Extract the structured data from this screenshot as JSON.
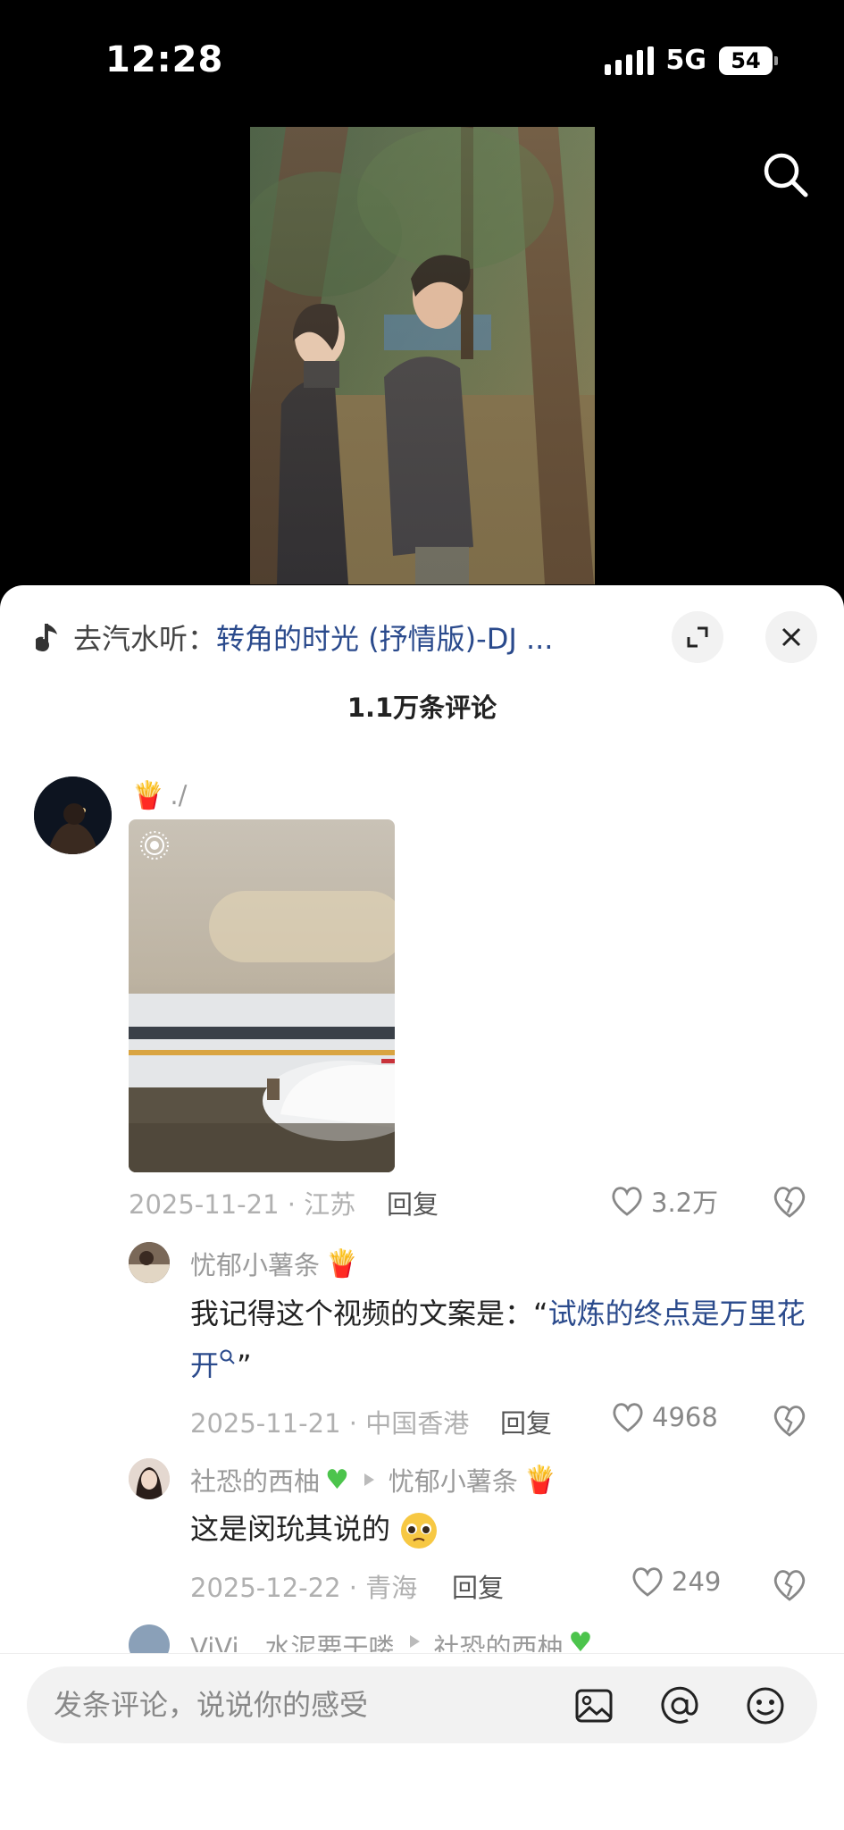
{
  "status": {
    "time": "12:28",
    "network": "5G",
    "battery": "54"
  },
  "music": {
    "prefix": "去汽水听：",
    "song": "转角的时光 (抒情版)-DJ ..."
  },
  "comments_count": "1.1万条评论",
  "top_comment": {
    "name": "./",
    "date_location": "2025-11-21 · 江苏",
    "reply_label": "回复",
    "likes": "3.2万"
  },
  "replies": [
    {
      "name": "忧郁小薯条",
      "text_prefix": "我记得这个视频的文案是：“",
      "text_link": "试炼的终点是万里花开",
      "text_suffix": "”",
      "date_location": "2025-11-21 · 中国香港",
      "reply_label": "回复",
      "likes": "4968"
    },
    {
      "name": "社恐的西柚",
      "reply_to": "忧郁小薯条",
      "text": "这是闵玧其说的",
      "date_location": "2025-12-22 · 青海",
      "reply_label": "回复",
      "likes": "249"
    },
    {
      "name": "ViVi＿水泥要干喽",
      "reply_to": "社恐的西柚"
    }
  ],
  "input": {
    "placeholder": "发条评论，说说你的感受"
  },
  "icons": [
    "search-icon",
    "music-note-icon",
    "expand-icon",
    "close-icon",
    "heart-icon",
    "broken-heart-icon",
    "image-icon",
    "at-icon",
    "emoji-icon",
    "fries-emoji-icon",
    "green-heart-emoji-icon",
    "pleading-face-emoji-icon",
    "live-photo-icon",
    "play-triangle-icon"
  ]
}
